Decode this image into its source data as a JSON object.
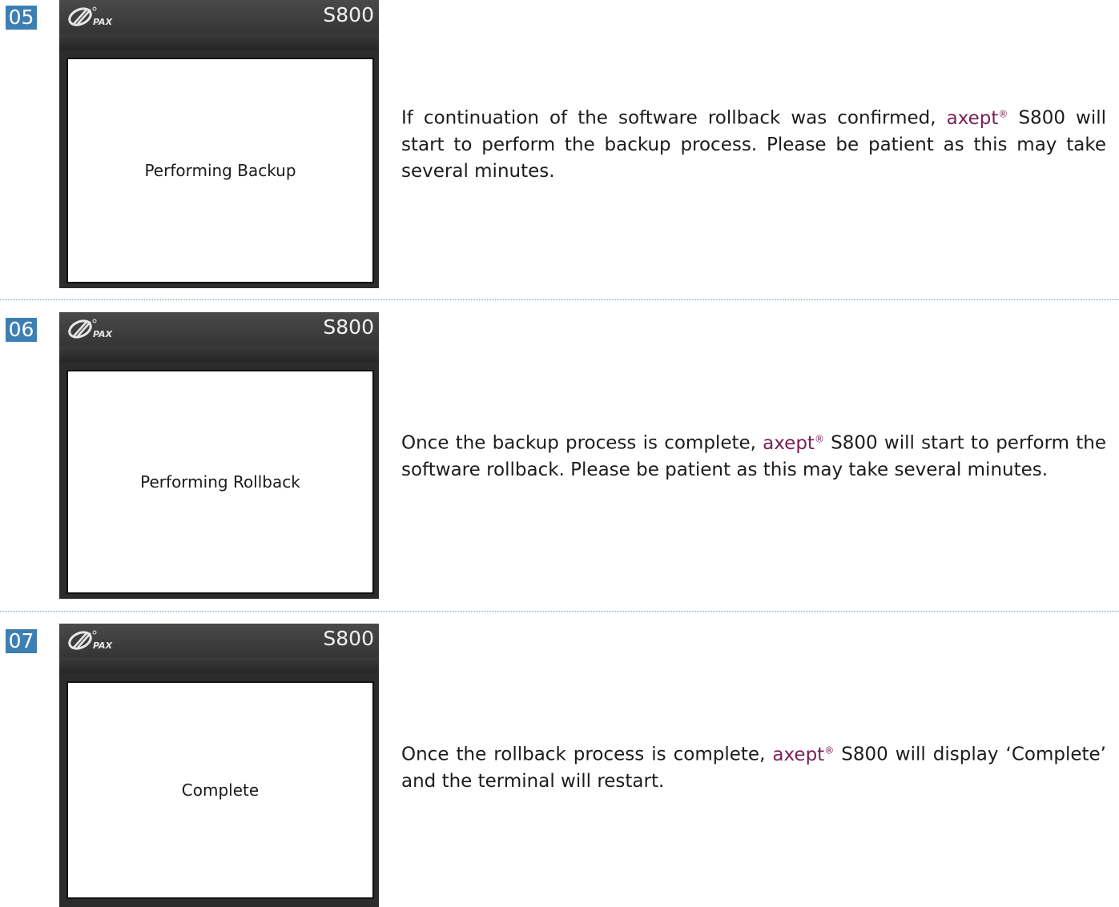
{
  "steps": [
    {
      "number": "05",
      "device_model": "S800",
      "logo_text": "PAX",
      "screen_text": "Performing Backup",
      "desc_before": "If continuation of the software rollback was confirmed, ",
      "brand": "axept",
      "brand_mark": "®",
      "desc_after": " S800 will start to perform the backup process.  Please be patient as this may take several minutes."
    },
    {
      "number": "06",
      "device_model": "S800",
      "logo_text": "PAX",
      "screen_text": "Performing Rollback",
      "desc_before": "Once the backup process is complete, ",
      "brand": "axept",
      "brand_mark": "®",
      "desc_after": " S800 will start to perform the software rollback.  Please be patient as this may take several minutes."
    },
    {
      "number": "07",
      "device_model": "S800",
      "logo_text": "PAX",
      "screen_text": "Complete",
      "desc_before": "Once the rollback process is complete, ",
      "brand": "axept",
      "brand_mark": "®",
      "desc_after": " S800 will display ‘Complete’ and the terminal will restart."
    }
  ],
  "colors": {
    "step_badge": "#3d7fb3",
    "brand": "#7a1f55",
    "device_body": "#2c2c2c",
    "divider": "#7a9bbb"
  },
  "icons": {
    "logo": "pax-logo-icon"
  }
}
